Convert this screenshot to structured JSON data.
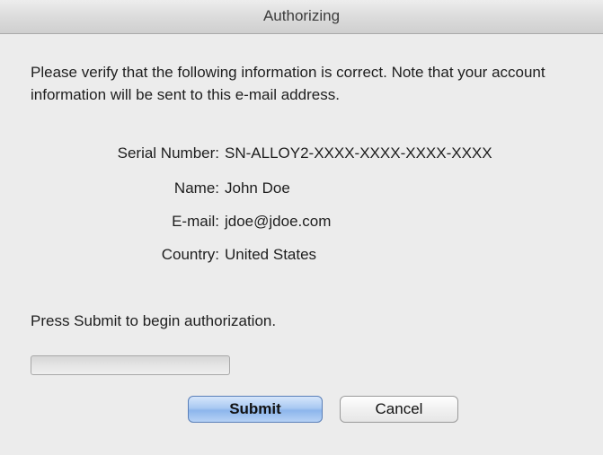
{
  "window": {
    "title": "Authorizing"
  },
  "message": {
    "text": "Please verify that the following information is correct. Note that your account information will be sent to this e-mail address."
  },
  "info": [
    {
      "label": "Serial Number:",
      "value": "SN-ALLOY2-XXXX-XXXX-XXXX-XXXX"
    },
    {
      "label": "Name:",
      "value": "John Doe"
    },
    {
      "label": "E-mail:",
      "value": "jdoe@jdoe.com"
    },
    {
      "label": "Country:",
      "value": "United States"
    }
  ],
  "prompt": {
    "text": "Press Submit to begin authorization."
  },
  "progress": {
    "value": 0
  },
  "buttons": {
    "submit_label": "Submit",
    "cancel_label": "Cancel"
  },
  "colors": {
    "accent": "#a9c9f2",
    "background": "#ececec"
  }
}
